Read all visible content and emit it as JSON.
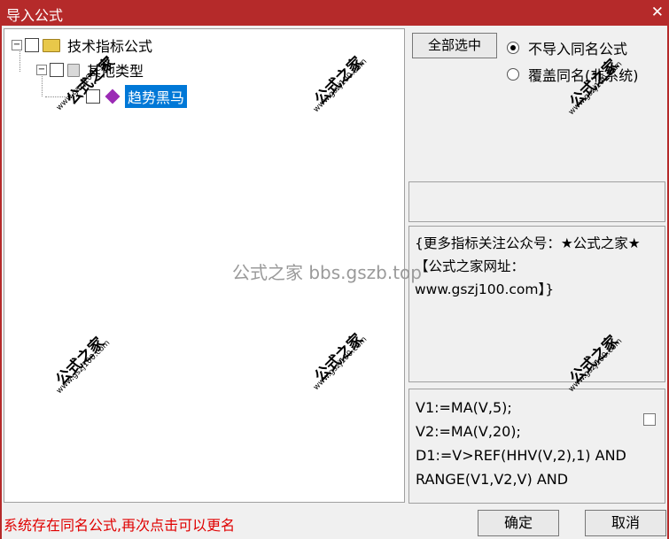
{
  "window": {
    "title": "导入公式",
    "close_glyph": "✕"
  },
  "tree": {
    "root": {
      "expander": "−",
      "label": "技术指标公式"
    },
    "child": {
      "expander": "−",
      "label": "其他类型"
    },
    "leaf": {
      "label": "趋势黑马"
    }
  },
  "options": {
    "select_all": "全部选中",
    "radio_skip": "不导入同名公式",
    "radio_overwrite": "覆盖同名(非系统)"
  },
  "description": "{更多指标关注公众号：★公式之家★ 【公式之家网址：www.gszj100.com】}",
  "formula_lines": [
    "V1:=MA(V,5);",
    "V2:=MA(V,20);",
    "D1:=V>REF(HHV(V,2),1) AND",
    "RANGE(V1,V2,V) AND"
  ],
  "status": "系统存在同名公式,再次点击可以更名",
  "buttons": {
    "ok": "确定",
    "cancel": "取消"
  },
  "watermark": {
    "brand": "公式之家",
    "url": "www.gszj100.com",
    "center": "公式之家 bbs.gszb.top"
  }
}
